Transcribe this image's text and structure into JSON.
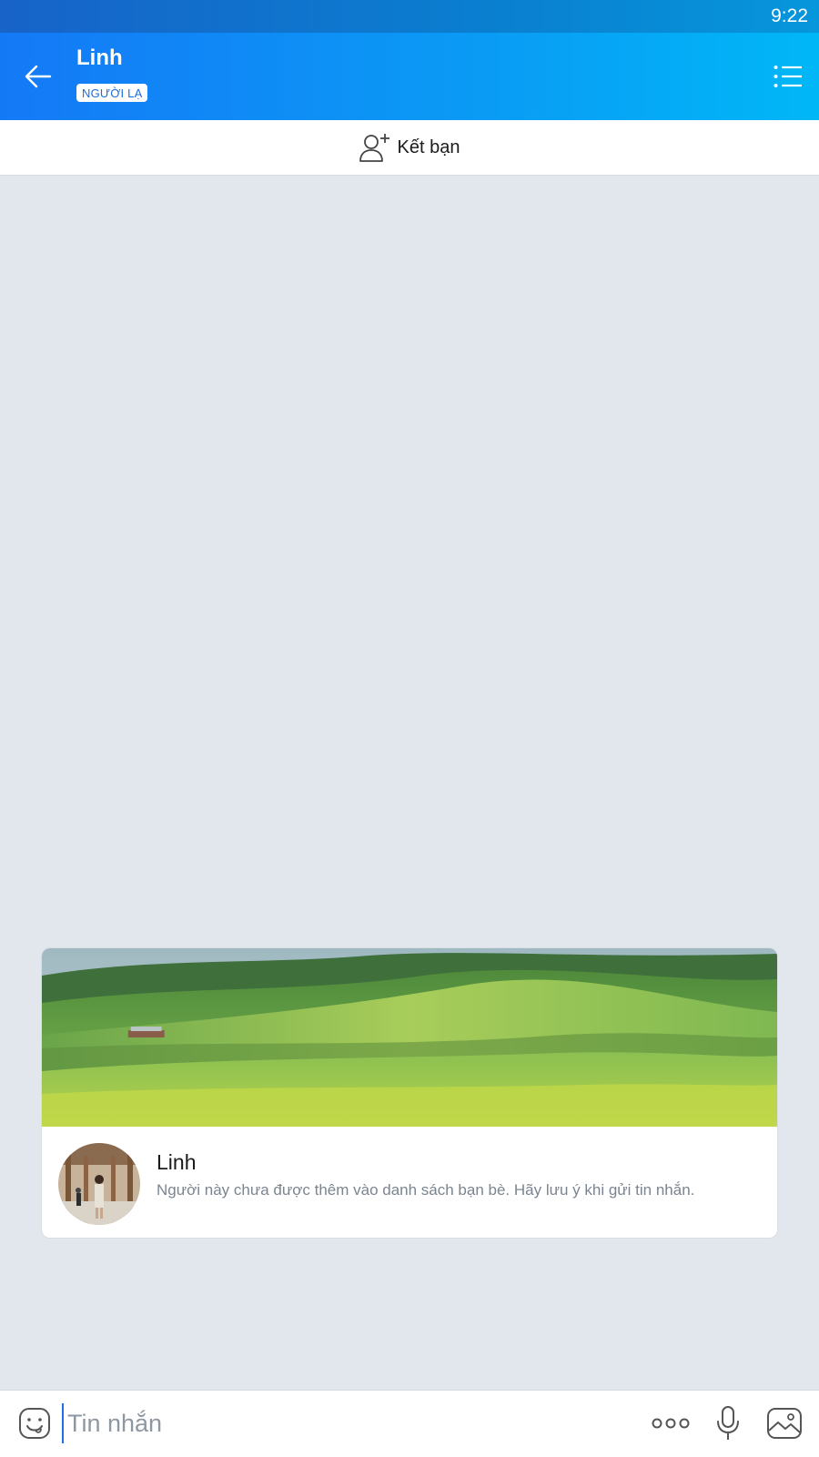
{
  "status_bar": {
    "time": "9:22"
  },
  "header": {
    "title": "Linh",
    "badge": "NGƯỜI LẠ",
    "back_icon": "arrow-left-icon",
    "menu_icon": "list-menu-icon"
  },
  "add_friend": {
    "label": "Kết bạn",
    "icon": "add-person-icon"
  },
  "profile_card": {
    "name": "Linh",
    "note": "Người này chưa được thêm vào danh sách bạn bè. Hãy lưu ý khi gửi tin nhắn."
  },
  "composer": {
    "placeholder": "Tin nhắn",
    "value": "",
    "icons": [
      "emoji-icon",
      "more-dots-icon",
      "microphone-icon",
      "image-icon"
    ]
  },
  "colors": {
    "header_start": "#1479f6",
    "header_end": "#00b7f6",
    "badge_text": "#1a6fe0",
    "chat_background": "#e2e7ee",
    "accent": "#1a73e8"
  }
}
